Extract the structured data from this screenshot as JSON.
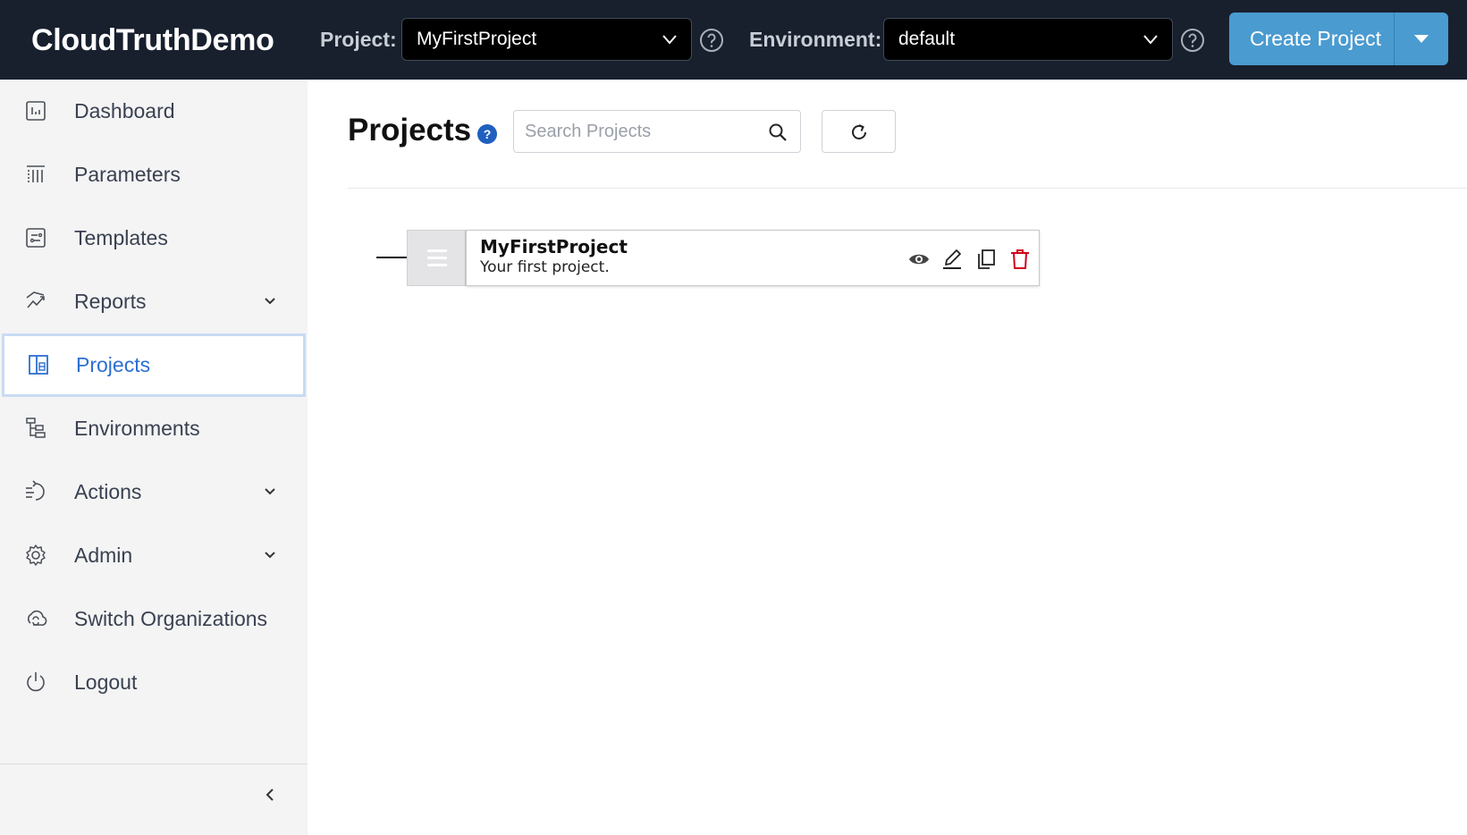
{
  "header": {
    "brand": "CloudTruthDemo",
    "project_label": "Project:",
    "project_value": "MyFirstProject",
    "environment_label": "Environment:",
    "environment_value": "default",
    "create_button_label": "Create Project"
  },
  "sidebar": {
    "items": [
      {
        "label": "Dashboard",
        "icon": "dashboard-icon"
      },
      {
        "label": "Parameters",
        "icon": "parameters-icon"
      },
      {
        "label": "Templates",
        "icon": "templates-icon"
      },
      {
        "label": "Reports",
        "icon": "reports-icon",
        "expandable": true
      },
      {
        "label": "Projects",
        "icon": "projects-icon",
        "active": true
      },
      {
        "label": "Environments",
        "icon": "environments-icon"
      },
      {
        "label": "Actions",
        "icon": "actions-icon",
        "expandable": true
      },
      {
        "label": "Admin",
        "icon": "admin-gear-icon",
        "expandable": true
      },
      {
        "label": "Switch Organizations",
        "icon": "switch-organizations-icon"
      },
      {
        "label": "Logout",
        "icon": "power-icon"
      }
    ]
  },
  "main": {
    "title": "Projects",
    "help_glyph": "?",
    "search_placeholder": "Search Projects",
    "projects": [
      {
        "name": "MyFirstProject",
        "description": "Your first project."
      }
    ]
  },
  "colors": {
    "header_bg": "#18202e",
    "accent_button": "#4a9bd0",
    "active_nav_text": "#2c6fd1",
    "active_nav_border": "#c8dbf3",
    "sidebar_bg": "#f4f4f5",
    "delete_red": "#d0021b",
    "help_badge": "#1f5fbf"
  }
}
